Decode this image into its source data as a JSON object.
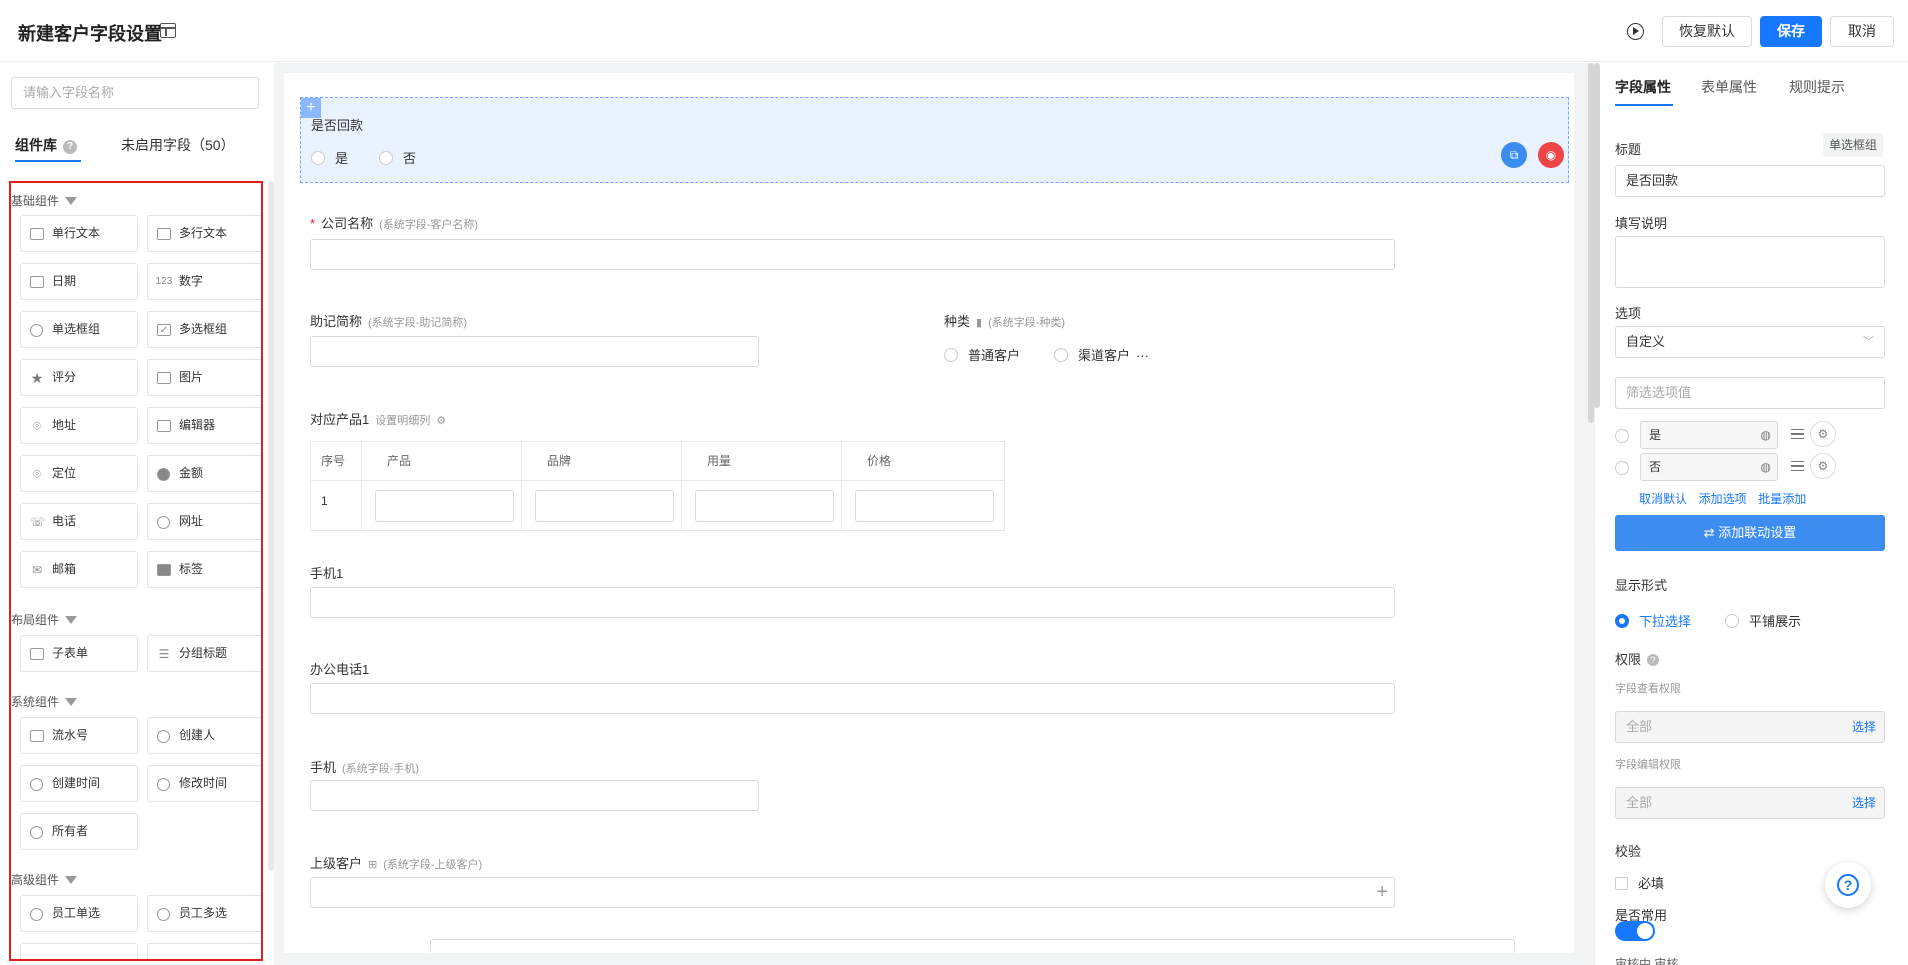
{
  "header": {
    "title": "新建客户字段设置",
    "restore_label": "恢复默认",
    "save_label": "保存",
    "cancel_label": "取消"
  },
  "left_panel": {
    "search_placeholder": "请输入字段名称",
    "tabs": [
      {
        "label": "组件库",
        "active": true
      },
      {
        "label": "未启用字段（50）",
        "active": false
      }
    ],
    "groups": [
      {
        "title": "基础组件",
        "items": [
          {
            "label": "单行文本",
            "icon": "single-line-text-icon"
          },
          {
            "label": "多行文本",
            "icon": "multi-line-text-icon"
          },
          {
            "label": "日期",
            "icon": "calendar-icon"
          },
          {
            "label": "数字",
            "icon": "number-icon"
          },
          {
            "label": "单选框组",
            "icon": "radio-icon"
          },
          {
            "label": "多选框组",
            "icon": "checkbox-icon"
          },
          {
            "label": "评分",
            "icon": "star-icon"
          },
          {
            "label": "图片",
            "icon": "image-icon"
          },
          {
            "label": "地址",
            "icon": "location-pin-icon"
          },
          {
            "label": "编辑器",
            "icon": "editor-icon"
          },
          {
            "label": "定位",
            "icon": "map-pin-icon"
          },
          {
            "label": "金额",
            "icon": "money-icon"
          },
          {
            "label": "电话",
            "icon": "phone-icon"
          },
          {
            "label": "网址",
            "icon": "globe-icon"
          },
          {
            "label": "邮箱",
            "icon": "mail-icon"
          },
          {
            "label": "标签",
            "icon": "tag-icon"
          }
        ]
      },
      {
        "title": "布局组件",
        "items": [
          {
            "label": "子表单",
            "icon": "table-icon"
          },
          {
            "label": "分组标题",
            "icon": "group-title-icon"
          }
        ]
      },
      {
        "title": "系统组件",
        "items": [
          {
            "label": "流水号",
            "icon": "serial-number-icon"
          },
          {
            "label": "创建人",
            "icon": "user-icon"
          },
          {
            "label": "创建时间",
            "icon": "clock-icon"
          },
          {
            "label": "修改时间",
            "icon": "edit-time-icon"
          },
          {
            "label": "所有者",
            "icon": "owner-icon"
          }
        ]
      },
      {
        "title": "高级组件",
        "items": [
          {
            "label": "员工单选",
            "icon": "employee-icon"
          },
          {
            "label": "员工多选",
            "icon": "employees-icon"
          }
        ]
      }
    ]
  },
  "canvas": {
    "selected_field": {
      "label": "是否回款",
      "options": [
        "是",
        "否"
      ]
    },
    "company_name": {
      "label": "公司名称",
      "sys": "(系统字段-客户名称)"
    },
    "short_name": {
      "label": "助记简称",
      "sys": "(系统字段-助记简称)"
    },
    "category": {
      "label": "种类",
      "sys": "(系统字段-种类)",
      "options": [
        "普通客户",
        "渠道客户"
      ],
      "more": "···"
    },
    "product": {
      "label": "对应产品1",
      "sub": "设置明细列",
      "columns": [
        "序号",
        "产品",
        "品牌",
        "用量",
        "价格"
      ],
      "row_index": "1"
    },
    "mobile1": {
      "label": "手机1"
    },
    "office_phone": {
      "label": "办公电话1"
    },
    "mobile": {
      "label": "手机",
      "sys": "(系统字段-手机)"
    },
    "parent_customer": {
      "label": "上级客户",
      "sys": "(系统字段-上级客户)"
    }
  },
  "right_panel": {
    "tabs": [
      "字段属性",
      "表单属性",
      "规则提示"
    ],
    "title_label": "标题",
    "type_badge": "单选框组",
    "title_value": "是否回款",
    "desc_label": "填写说明",
    "options_label": "选项",
    "options_mode": "自定义",
    "filter_placeholder": "筛选选项值",
    "options": [
      "是",
      "否"
    ],
    "option_links": [
      "取消默认",
      "添加选项",
      "批量添加"
    ],
    "linkage_button": "添加联动设置",
    "display_label": "显示形式",
    "display_options": [
      "下拉选择",
      "平铺展示"
    ],
    "permission_label": "权限",
    "view_perm_label": "字段查看权限",
    "view_perm_value": "全部",
    "edit_perm_label": "字段编辑权限",
    "edit_perm_value": "全部",
    "choose_link": "选择",
    "validate_label": "校验",
    "required_label": "必填",
    "common_label": "是否常用",
    "bottom_text": "审核中  审核"
  }
}
